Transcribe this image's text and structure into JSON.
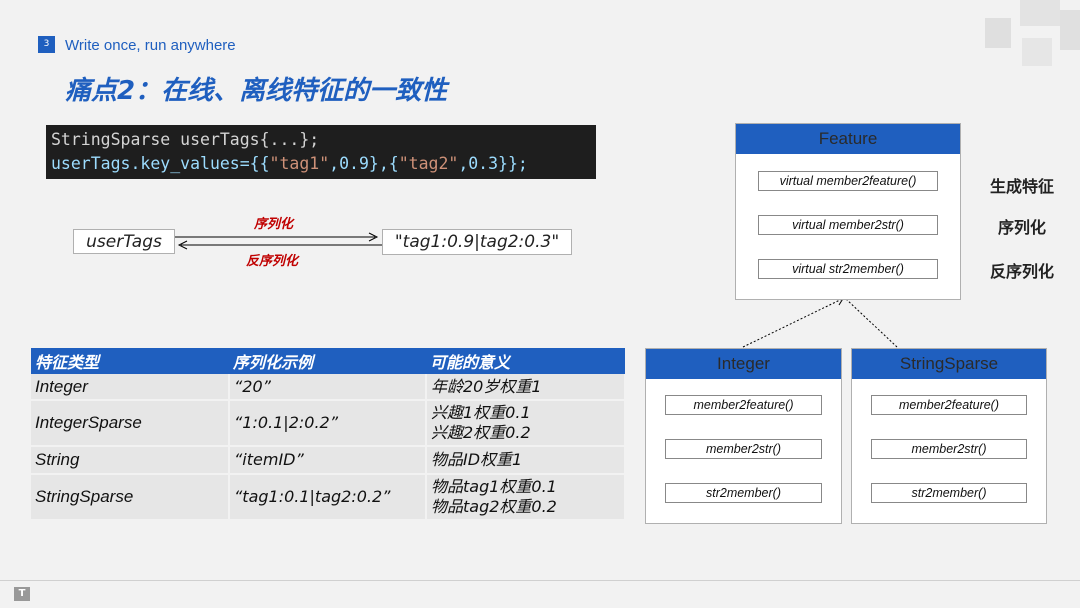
{
  "header": {
    "slide_number": "3",
    "subtitle": "Write once, run anywhere",
    "title": "痛点2：在线、离线特征的一致性"
  },
  "code": {
    "line1": "StringSparse userTags{...};",
    "line2_a": "userTags.key_values={{",
    "line2_s1": "\"tag1\"",
    "line2_b": ",0.9},{",
    "line2_s2": "\"tag2\"",
    "line2_c": ",0.3}};"
  },
  "flow": {
    "left": "userTags",
    "right": "\"tag1:0.9|tag2:0.3\"",
    "serialize": "序列化",
    "deserialize": "反序列化"
  },
  "table": {
    "headers": [
      "特征类型",
      "序列化示例",
      "可能的意义"
    ],
    "rows": [
      {
        "type": "Integer",
        "example": "“20”",
        "meaning1": "年龄20岁权重1",
        "meaning2": ""
      },
      {
        "type": "IntegerSparse",
        "example": "“1:0.1|2:0.2”",
        "meaning1": "兴趣1权重0.1",
        "meaning2": "兴趣2权重0.2"
      },
      {
        "type": "String",
        "example": "“itemID”",
        "meaning1": "物品ID权重1",
        "meaning2": ""
      },
      {
        "type": "StringSparse",
        "example": "“tag1:0.1|tag2:0.2”",
        "meaning1": "物品tag1权重0.1",
        "meaning2": "物品tag2权重0.2"
      }
    ]
  },
  "diagram": {
    "feature": {
      "title": "Feature",
      "methods": [
        "virtual member2feature()",
        "virtual member2str()",
        "virtual str2member()"
      ]
    },
    "labels": [
      "生成特征",
      "序列化",
      "反序列化"
    ],
    "integer": {
      "title": "Integer",
      "methods": [
        "member2feature()",
        "member2str()",
        "str2member()"
      ]
    },
    "stringsparse": {
      "title": "StringSparse",
      "methods": [
        "member2feature()",
        "member2str()",
        "str2member()"
      ]
    }
  },
  "footer": {
    "logo": "T"
  },
  "colors": {
    "accent": "#1f5fbf",
    "arrow_label": "#c00000"
  }
}
